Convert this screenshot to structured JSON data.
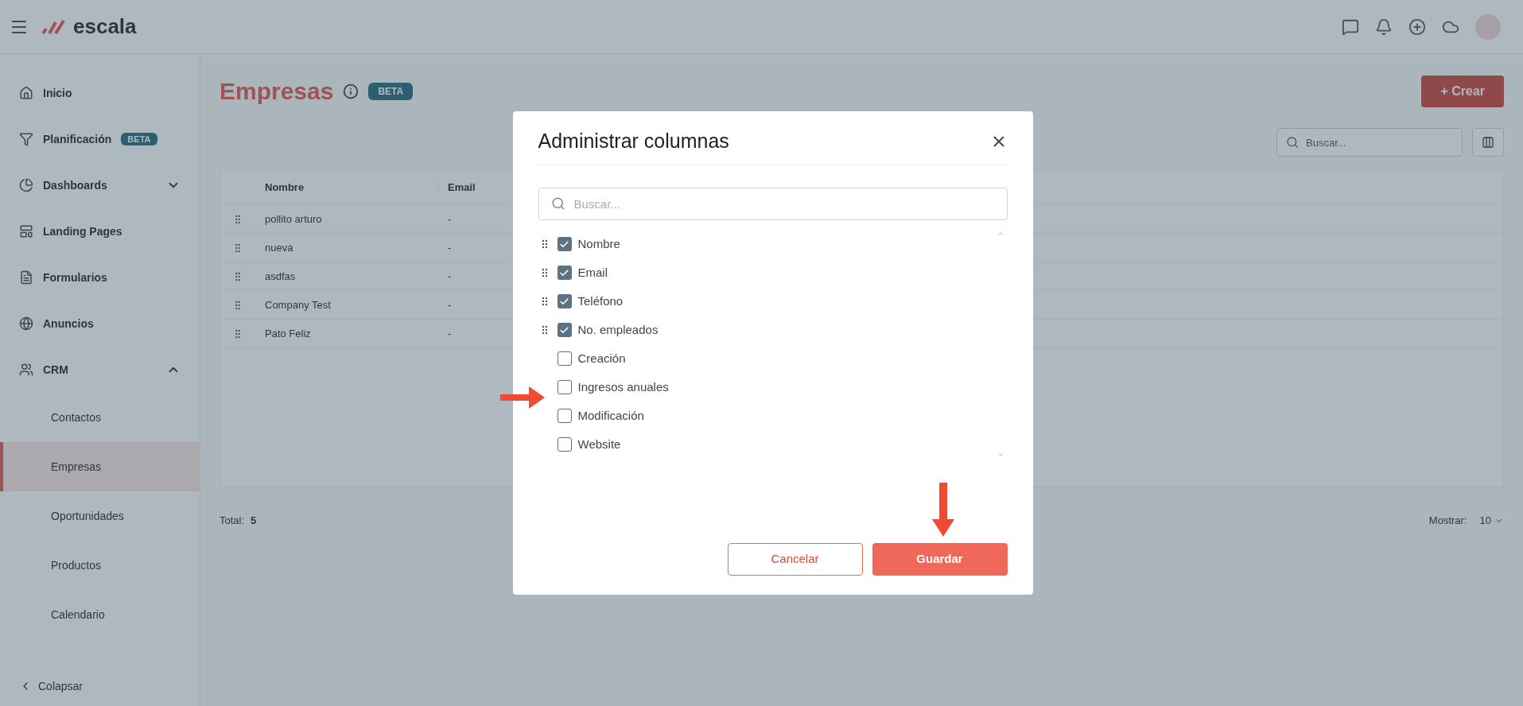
{
  "topbar": {
    "logo": "escala"
  },
  "sidebar": {
    "items": [
      {
        "label": "Inicio"
      },
      {
        "label": "Planificación",
        "badge": "BETA"
      },
      {
        "label": "Dashboards",
        "expanded": false
      },
      {
        "label": "Landing Pages"
      },
      {
        "label": "Formularios"
      },
      {
        "label": "Anuncios"
      },
      {
        "label": "CRM",
        "expanded": true,
        "children": [
          {
            "label": "Contactos",
            "selected": false
          },
          {
            "label": "Empresas",
            "selected": true
          },
          {
            "label": "Oportunidades",
            "selected": false
          },
          {
            "label": "Productos",
            "selected": false
          },
          {
            "label": "Calendario",
            "selected": false
          }
        ]
      }
    ],
    "collapse": "Colapsar"
  },
  "page": {
    "title": "Empresas",
    "badge": "BETA",
    "create_button": "+ Crear",
    "search": {
      "placeholder": "Buscar..."
    },
    "table": {
      "columns": [
        "Nombre",
        "Email"
      ],
      "rows": [
        [
          "pollito arturo",
          "-"
        ],
        [
          "nueva",
          "-"
        ],
        [
          "asdfas",
          "-"
        ],
        [
          "Company Test",
          "-"
        ],
        [
          "Pato Feliz",
          "-"
        ]
      ]
    },
    "total_label": "Total:",
    "total": "5",
    "show_label": "Mostrar:",
    "page_size": "10"
  },
  "dialog": {
    "title": "Administrar columnas",
    "search": {
      "placeholder": "Buscar..."
    },
    "columns": [
      {
        "label": "Nombre",
        "checked": true
      },
      {
        "label": "Email",
        "checked": true
      },
      {
        "label": "Teléfono",
        "checked": true
      },
      {
        "label": "No. empleados",
        "checked": true
      },
      {
        "label": "Creación",
        "checked": false
      },
      {
        "label": "Ingresos anuales",
        "checked": false
      },
      {
        "label": "Modificación",
        "checked": false
      },
      {
        "label": "Website",
        "checked": false
      }
    ],
    "cancel_button": "Cancelar",
    "save_button": "Guardar"
  }
}
